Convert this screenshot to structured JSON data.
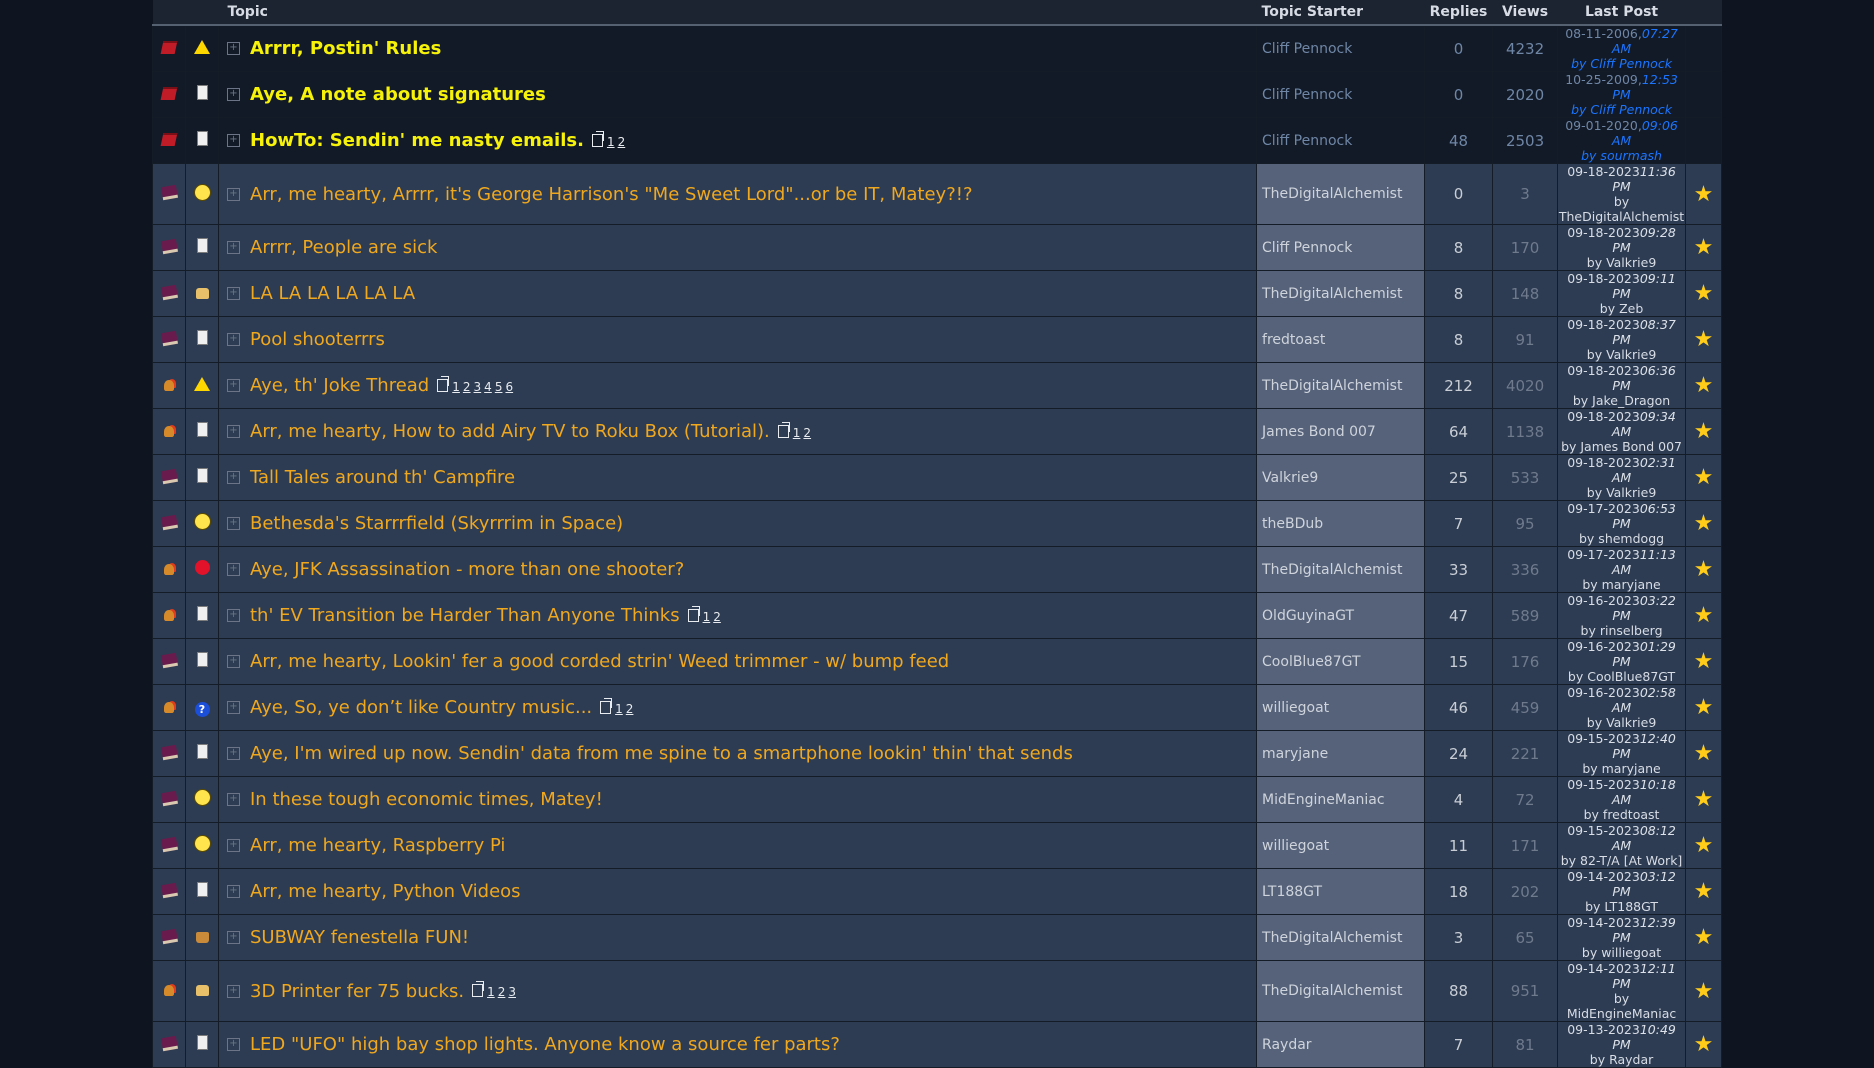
{
  "header": {
    "topic": "Topic",
    "starter": "Topic Starter",
    "replies": "Replies",
    "views": "Views",
    "last_post": "Last Post"
  },
  "threads": [
    {
      "sticky": true,
      "status_icon": "folder-icon",
      "post_icon": "warning-icon",
      "title": "Arrrr, Postin' Rules",
      "pages": [],
      "starter": "Cliff Pennock",
      "replies": "0",
      "views": "4232",
      "date": "08-11-2006,",
      "time": "07:27 AM",
      "by": "by Cliff Pennock",
      "star": ""
    },
    {
      "sticky": true,
      "status_icon": "folder-icon",
      "post_icon": "document-icon",
      "title": "Aye, A note about signatures",
      "pages": [],
      "starter": "Cliff Pennock",
      "replies": "0",
      "views": "2020",
      "date": "10-25-2009,",
      "time": "12:53 PM",
      "by": "by Cliff Pennock",
      "star": ""
    },
    {
      "sticky": true,
      "status_icon": "folder-icon",
      "post_icon": "document-icon",
      "title": "HowTo: Sendin' me nasty emails.",
      "pages": [
        "1",
        "2"
      ],
      "starter": "Cliff Pennock",
      "replies": "48",
      "views": "2503",
      "date": "09-01-2020,",
      "time": "09:06 AM",
      "by": "by sourmash",
      "star": ""
    },
    {
      "sticky": false,
      "status_icon": "book-icon",
      "post_icon": "smile-icon",
      "title": "Arr, me hearty, Arrrr, it's George Harrison's \"Me Sweet Lord\"...or be IT, Matey?!?",
      "pages": [],
      "starter": "TheDigitalAlchemist",
      "replies": "0",
      "views": "3",
      "date": "09-18-2023",
      "time": "11:36 PM",
      "by": "by TheDigitalAlchemist",
      "star": "★"
    },
    {
      "sticky": false,
      "status_icon": "book-icon",
      "post_icon": "document-icon",
      "title": "Arrrr, People are sick",
      "pages": [],
      "starter": "Cliff Pennock",
      "replies": "8",
      "views": "170",
      "date": "09-18-2023",
      "time": "09:28 PM",
      "by": "by Valkrie9",
      "star": "★"
    },
    {
      "sticky": false,
      "status_icon": "book-icon",
      "post_icon": "thumbs-up-icon",
      "title": "LA LA LA LA LA LA",
      "pages": [],
      "starter": "TheDigitalAlchemist",
      "replies": "8",
      "views": "148",
      "date": "09-18-2023",
      "time": "09:11 PM",
      "by": "by Zeb",
      "star": "★"
    },
    {
      "sticky": false,
      "status_icon": "book-icon",
      "post_icon": "document-icon",
      "title": "Pool shooterrrs",
      "pages": [],
      "starter": "fredtoast",
      "replies": "8",
      "views": "91",
      "date": "09-18-2023",
      "time": "08:37 PM",
      "by": "by Valkrie9",
      "star": "★"
    },
    {
      "sticky": false,
      "status_icon": "hot-icon",
      "post_icon": "warning-icon",
      "title": "Aye, th' Joke Thread",
      "pages": [
        "1",
        "2",
        "3",
        "4",
        "5",
        "6"
      ],
      "starter": "TheDigitalAlchemist",
      "replies": "212",
      "views": "4020",
      "date": "09-18-2023",
      "time": "06:36 PM",
      "by": "by Jake_Dragon",
      "star": "★"
    },
    {
      "sticky": false,
      "status_icon": "hot-icon",
      "post_icon": "document-icon",
      "title": "Arr, me hearty, How to add Airy TV to Roku Box (Tutorial).",
      "pages": [
        "1",
        "2"
      ],
      "starter": "James Bond 007",
      "replies": "64",
      "views": "1138",
      "date": "09-18-2023",
      "time": "09:34 AM",
      "by": "by James Bond 007",
      "star": "★"
    },
    {
      "sticky": false,
      "status_icon": "book-icon",
      "post_icon": "document-icon",
      "title": "Tall Tales around th' Campfire",
      "pages": [],
      "starter": "Valkrie9",
      "replies": "25",
      "views": "533",
      "date": "09-18-2023",
      "time": "02:31 AM",
      "by": "by Valkrie9",
      "star": "★"
    },
    {
      "sticky": false,
      "status_icon": "book-icon",
      "post_icon": "cool-icon",
      "title": "Bethesda's Starrrfield (Skyrrrim in Space)",
      "pages": [],
      "starter": "theBDub",
      "replies": "7",
      "views": "95",
      "date": "09-17-2023",
      "time": "06:53 PM",
      "by": "by shemdogg",
      "star": "★"
    },
    {
      "sticky": false,
      "status_icon": "hot-icon",
      "post_icon": "angry-icon",
      "title": "Aye, JFK Assassination - more than one shooter?",
      "pages": [],
      "starter": "TheDigitalAlchemist",
      "replies": "33",
      "views": "336",
      "date": "09-17-2023",
      "time": "11:13 AM",
      "by": "by maryjane",
      "star": "★"
    },
    {
      "sticky": false,
      "status_icon": "hot-icon",
      "post_icon": "document-icon",
      "title": "th' EV Transition be Harder Than Anyone Thinks",
      "pages": [
        "1",
        "2"
      ],
      "starter": "OldGuyinaGT",
      "replies": "47",
      "views": "589",
      "date": "09-16-2023",
      "time": "03:22 PM",
      "by": "by rinselberg",
      "star": "★"
    },
    {
      "sticky": false,
      "status_icon": "book-icon",
      "post_icon": "document-icon",
      "title": "Arr, me hearty, Lookin' fer a good corded strin' Weed trimmer - w/ bump feed",
      "pages": [],
      "starter": "CoolBlue87GT",
      "replies": "15",
      "views": "176",
      "date": "09-16-2023",
      "time": "01:29 PM",
      "by": "by CoolBlue87GT",
      "star": "★"
    },
    {
      "sticky": false,
      "status_icon": "hot-icon",
      "post_icon": "question-icon",
      "title": "Aye, So, ye don’t like Country music...",
      "pages": [
        "1",
        "2"
      ],
      "starter": "williegoat",
      "replies": "46",
      "views": "459",
      "date": "09-16-2023",
      "time": "02:58 AM",
      "by": "by Valkrie9",
      "star": "★"
    },
    {
      "sticky": false,
      "status_icon": "book-icon",
      "post_icon": "document-icon",
      "title": "Aye, I'm wired up now. Sendin' data from me spine to a smartphone lookin' thin' that sends",
      "pages": [],
      "starter": "maryjane",
      "replies": "24",
      "views": "221",
      "date": "09-15-2023",
      "time": "12:40 PM",
      "by": "by maryjane",
      "star": "★"
    },
    {
      "sticky": false,
      "status_icon": "book-icon",
      "post_icon": "wink-icon",
      "title": "In these tough economic times, Matey!",
      "pages": [],
      "starter": "MidEngineManiac",
      "replies": "4",
      "views": "72",
      "date": "09-15-2023",
      "time": "10:18 AM",
      "by": "by fredtoast",
      "star": "★"
    },
    {
      "sticky": false,
      "status_icon": "book-icon",
      "post_icon": "smile-icon",
      "title": "Arr, me hearty, Raspberry Pi",
      "pages": [],
      "starter": "williegoat",
      "replies": "11",
      "views": "171",
      "date": "09-15-2023",
      "time": "08:12 AM",
      "by": "by 82-T/A [At Work]",
      "star": "★"
    },
    {
      "sticky": false,
      "status_icon": "book-icon",
      "post_icon": "document-icon",
      "title": "Arr, me hearty, Python Videos",
      "pages": [],
      "starter": "LT188GT",
      "replies": "18",
      "views": "202",
      "date": "09-14-2023",
      "time": "03:12 PM",
      "by": "by LT188GT",
      "star": "★"
    },
    {
      "sticky": false,
      "status_icon": "book-icon",
      "post_icon": "thumbs-down-icon",
      "title": "SUBWAY fenestella FUN!",
      "pages": [],
      "starter": "TheDigitalAlchemist",
      "replies": "3",
      "views": "65",
      "date": "09-14-2023",
      "time": "12:39 PM",
      "by": "by williegoat",
      "star": "★"
    },
    {
      "sticky": false,
      "status_icon": "hot-icon",
      "post_icon": "thumbs-up-icon",
      "title": "3D Printer fer 75 bucks.",
      "pages": [
        "1",
        "2",
        "3"
      ],
      "starter": "TheDigitalAlchemist",
      "replies": "88",
      "views": "951",
      "date": "09-14-2023",
      "time": "12:11 PM",
      "by": "by MidEngineManiac",
      "star": "★"
    },
    {
      "sticky": false,
      "status_icon": "book-icon",
      "post_icon": "document-icon",
      "title": "LED \"UFO\" high bay shop lights. Anyone know a source fer parts?",
      "pages": [],
      "starter": "Raydar",
      "replies": "7",
      "views": "81",
      "date": "09-13-2023",
      "time": "10:49 PM",
      "by": "by Raydar",
      "star": "★"
    }
  ]
}
